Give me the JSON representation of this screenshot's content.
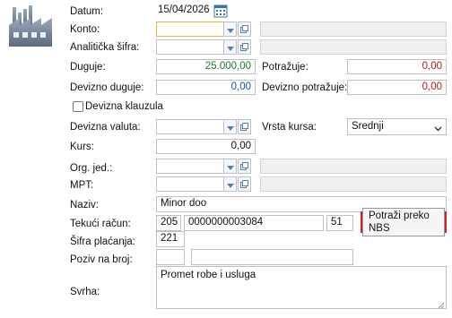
{
  "form": {
    "datum_label": "Datum:",
    "datum_value": "15/04/2026",
    "konto_label": "Konto:",
    "konto_value": "",
    "analiticka_label": "Analitička šifra:",
    "analiticka_value": "",
    "duguje_label": "Duguje:",
    "duguje_value": "25.000,00",
    "potrazuje_label": "Potražuje:",
    "potrazuje_value": "0,00",
    "devizno_duguje_label": "Devizno duguje:",
    "devizno_duguje_value": "0,00",
    "devizno_potrazuje_label": "Devizno potražuje:",
    "devizno_potrazuje_value": "0,00",
    "devizna_klauzula_label": "Devizna klauzula",
    "devizna_valuta_label": "Devizna valuta:",
    "devizna_valuta_value": "",
    "vrsta_kursa_label": "Vrsta kursa:",
    "vrsta_kursa_value": "Srednji",
    "kurs_label": "Kurs:",
    "kurs_value": "0,00",
    "org_jed_label": "Org. jed.:",
    "org_jed_value": "",
    "mpt_label": "MPT:",
    "mpt_value": "",
    "naziv_label": "Naziv:",
    "naziv_value": "Minor doo",
    "tekuci_racun_label": "Tekući račun:",
    "tekuci_racun_bank": "205",
    "tekuci_racun_number": "0000000003084",
    "tekuci_racun_control": "51",
    "potrazi_button": "Potraži preko NBS",
    "sifra_placanja_label": "Šifra plaćanja:",
    "sifra_placanja_value": "221",
    "poziv_label": "Poziv na broj:",
    "poziv_model": "",
    "poziv_value": "",
    "svrha_label": "Svrha:",
    "svrha_value": "Promet robe i usluga"
  },
  "colors": {
    "accent_green": "#1a7a2c",
    "accent_red": "#b01515",
    "highlight_border": "#d42020",
    "focus_border": "#e3b64a"
  },
  "icons": {
    "logo": "factory-icon",
    "calendar": "calendar-icon",
    "dropdown": "chevron-down-icon",
    "lookup": "copy-window-icon"
  }
}
